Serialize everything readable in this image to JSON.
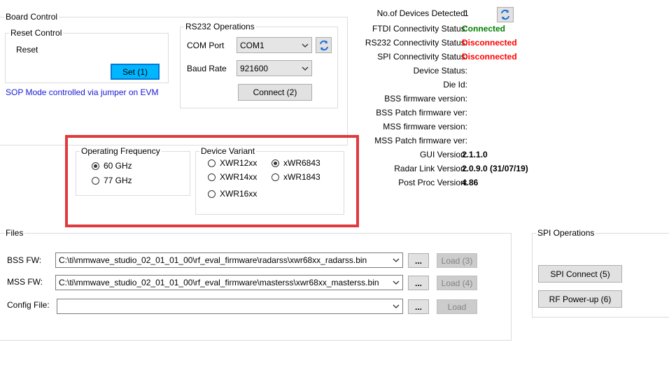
{
  "board_control": {
    "title": "Board Control",
    "reset_control": {
      "title": "Reset Control",
      "label": "Reset",
      "set_button": "Set (1)"
    },
    "sop_note": "SOP Mode controlled via jumper on EVM",
    "rs232": {
      "title": "RS232 Operations",
      "com_port_label": "COM Port",
      "com_port_value": "COM1",
      "baud_rate_label": "Baud Rate",
      "baud_rate_value": "921600",
      "connect_button": "Connect (2)"
    }
  },
  "operating_frequency": {
    "title": "Operating Frequency",
    "options": [
      {
        "label": "60 GHz",
        "selected": true
      },
      {
        "label": "77 GHz",
        "selected": false
      }
    ]
  },
  "device_variant": {
    "title": "Device Variant",
    "options": [
      {
        "label": "XWR12xx",
        "selected": false
      },
      {
        "label": "xWR6843",
        "selected": true
      },
      {
        "label": "XWR14xx",
        "selected": false
      },
      {
        "label": "xWR1843",
        "selected": false
      },
      {
        "label": "XWR16xx",
        "selected": false
      }
    ]
  },
  "status": {
    "devices_detected_label": "No.of Devices Detected:",
    "devices_detected_value": "1",
    "rows": [
      {
        "label": "FTDI Connectivity Status:",
        "value": "Connected",
        "color": "#008000"
      },
      {
        "label": "RS232 Connectivity Status:",
        "value": "Disconnected",
        "color": "#ff0000"
      },
      {
        "label": "SPI Connectivity Status:",
        "value": "Disconnected",
        "color": "#ff0000"
      },
      {
        "label": "Device Status:",
        "value": "",
        "color": "#000000"
      },
      {
        "label": "Die Id:",
        "value": "",
        "color": "#000000"
      },
      {
        "label": "BSS firmware version:",
        "value": "",
        "color": "#000000"
      },
      {
        "label": "BSS Patch firmware ver:",
        "value": "",
        "color": "#000000"
      },
      {
        "label": "MSS firmware version:",
        "value": "",
        "color": "#000000"
      },
      {
        "label": "MSS Patch firmware ver:",
        "value": "",
        "color": "#000000"
      },
      {
        "label": "GUI Version:",
        "value": "2.1.1.0",
        "color": "#000000"
      },
      {
        "label": "Radar Link Version:",
        "value": "2.0.9.0 (31/07/19)",
        "color": "#000000"
      },
      {
        "label": "Post Proc Version:",
        "value": "4.86",
        "color": "#000000"
      }
    ]
  },
  "files": {
    "title": "Files",
    "bss_label": "BSS FW:",
    "bss_value": "C:\\ti\\mmwave_studio_02_01_01_00\\rf_eval_firmware\\radarss\\xwr68xx_radarss.bin",
    "bss_load": "Load (3)",
    "mss_label": "MSS FW:",
    "mss_value": "C:\\ti\\mmwave_studio_02_01_01_00\\rf_eval_firmware\\masterss\\xwr68xx_masterss.bin",
    "mss_load": "Load (4)",
    "config_label": "Config File:",
    "config_value": "",
    "config_load": "Load",
    "browse": "..."
  },
  "spi": {
    "title": "SPI Operations",
    "connect_button": "SPI Connect (5)",
    "powerup_button": "RF Power-up (6)"
  },
  "colors": {
    "highlight_border": "#e0393e",
    "sop_note": "#1a1ad6",
    "set_button": "#00b7ff"
  }
}
